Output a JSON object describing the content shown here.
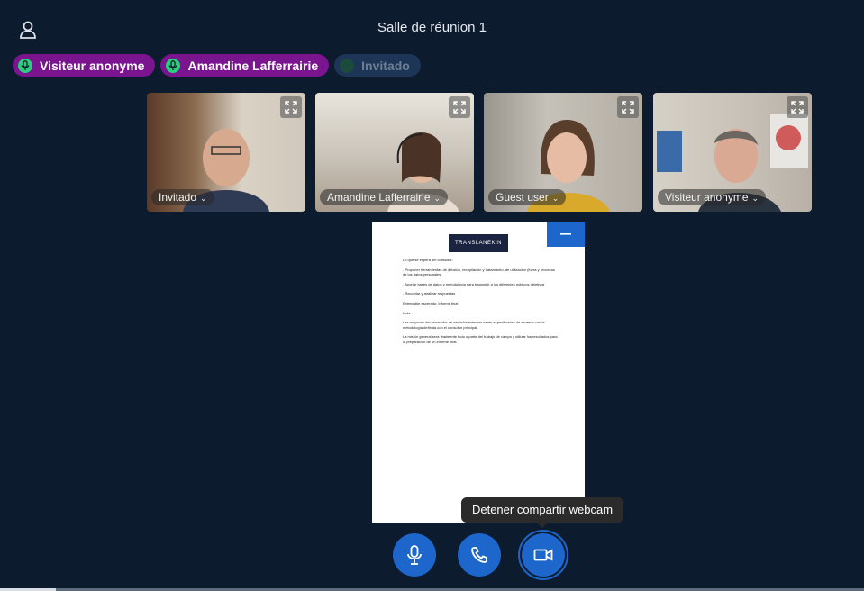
{
  "header": {
    "room_title": "Salle de réunion 1"
  },
  "participants": [
    {
      "name": "Visiteur anonyme",
      "active": true
    },
    {
      "name": "Amandine Lafferrairie",
      "active": true
    },
    {
      "name": "Invitado",
      "active": false
    }
  ],
  "tiles": [
    {
      "name": "Invitado",
      "bg": "#8b6a4f"
    },
    {
      "name": "Amandine Lafferrairie",
      "bg": "#c9c2b8"
    },
    {
      "name": "Guest user",
      "bg": "#b9b4ab"
    },
    {
      "name": "Visiteur anonyme",
      "bg": "#c7c0b6"
    }
  ],
  "document": {
    "logo_text": "TRANSLANEKIN",
    "lines": [
      "Lo que se espera del consultor:",
      "- Proponer herramientas de difusión, recopilación y tratamiento, de utilización (fuera y procesos de los datos personales",
      "- Aportar bases de datos y metodología para transmitir a los diferentes públicos objetivos",
      "- Recopilar y analizar respuestas",
      "Entregable esperado: Informe final",
      "Nota :",
      "Las mayorías del proveedor de servicios externos serán especificadas de acuerdo con la metodología definida con el consultor principal.",
      "La misión general será finalmente todo o parte del trabajo de campo y utilizar los resultados para la preparación de un informe final."
    ]
  },
  "tooltip": {
    "text": "Detener compartir webcam"
  },
  "controls": {
    "mic_icon": "microphone-icon",
    "phone_icon": "phone-icon",
    "camera_icon": "video-camera-icon"
  },
  "colors": {
    "background": "#0d1b2e",
    "accent": "#1c66cc",
    "chip": "#7a148f",
    "mic_active": "#28d07e"
  }
}
